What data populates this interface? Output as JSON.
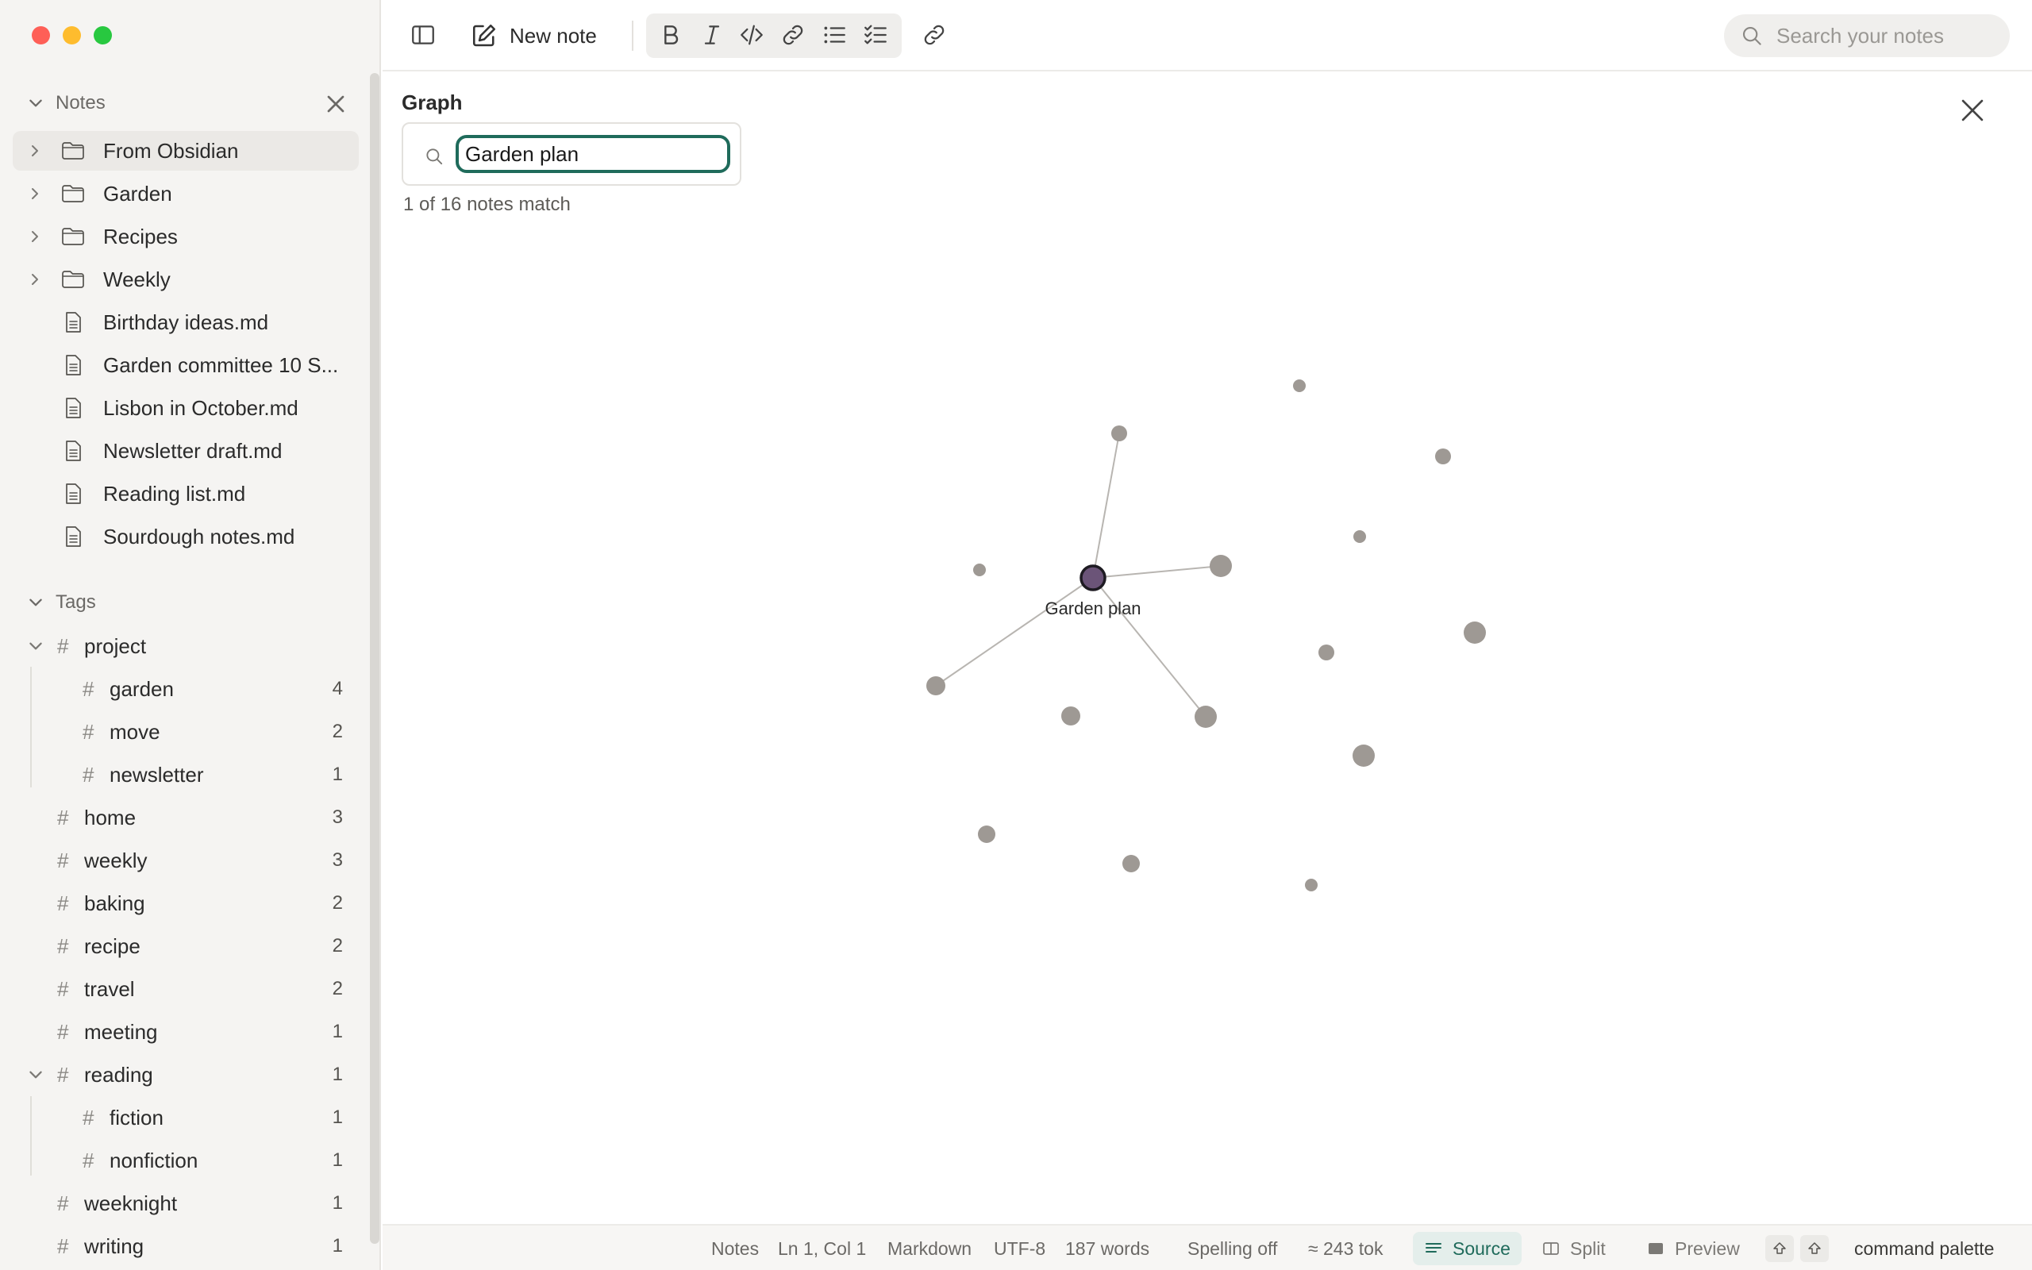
{
  "sidebar": {
    "notes_header": "Notes",
    "tags_header": "Tags",
    "tree": [
      {
        "label": "From Obsidian",
        "type": "folder"
      },
      {
        "label": "Garden",
        "type": "folder"
      },
      {
        "label": "Recipes",
        "type": "folder"
      },
      {
        "label": "Weekly",
        "type": "folder"
      },
      {
        "label": "Birthday ideas.md",
        "type": "file"
      },
      {
        "label": "Garden committee 10 S...",
        "type": "file"
      },
      {
        "label": "Lisbon in October.md",
        "type": "file"
      },
      {
        "label": "Newsletter draft.md",
        "type": "file"
      },
      {
        "label": "Reading list.md",
        "type": "file"
      },
      {
        "label": "Sourdough notes.md",
        "type": "file"
      }
    ],
    "tags": [
      {
        "label": "project",
        "count": "",
        "level": 0,
        "expanded": true
      },
      {
        "label": "garden",
        "count": "4",
        "level": 1
      },
      {
        "label": "move",
        "count": "2",
        "level": 1
      },
      {
        "label": "newsletter",
        "count": "1",
        "level": 1
      },
      {
        "label": "home",
        "count": "3",
        "level": 0
      },
      {
        "label": "weekly",
        "count": "3",
        "level": 0
      },
      {
        "label": "baking",
        "count": "2",
        "level": 0
      },
      {
        "label": "recipe",
        "count": "2",
        "level": 0
      },
      {
        "label": "travel",
        "count": "2",
        "level": 0
      },
      {
        "label": "meeting",
        "count": "1",
        "level": 0
      },
      {
        "label": "reading",
        "count": "1",
        "level": 0,
        "expanded": true
      },
      {
        "label": "fiction",
        "count": "1",
        "level": 1
      },
      {
        "label": "nonfiction",
        "count": "1",
        "level": 1
      },
      {
        "label": "weeknight",
        "count": "1",
        "level": 0
      },
      {
        "label": "writing",
        "count": "1",
        "level": 0
      }
    ]
  },
  "toolbar": {
    "new_note_label": "New note",
    "search_placeholder": "Search your notes"
  },
  "graph": {
    "title": "Graph",
    "filter_value": "Garden plan",
    "match_text": "1 of 16 notes match",
    "focus_label": "Garden plan"
  },
  "statusbar": {
    "items": [
      "Notes",
      "Ln 1, Col 1",
      "Markdown",
      "UTF-8",
      "187 words",
      "Spelling off",
      "≈ 243 tok"
    ],
    "modes": [
      "Source",
      "Split",
      "Preview"
    ],
    "active_mode": "Source",
    "palette_label": "command palette"
  },
  "colors": {
    "accent": "#1f6b5b",
    "focus_node": "#6b5478",
    "node": "#9e9994",
    "edge": "#b8b5b1"
  }
}
